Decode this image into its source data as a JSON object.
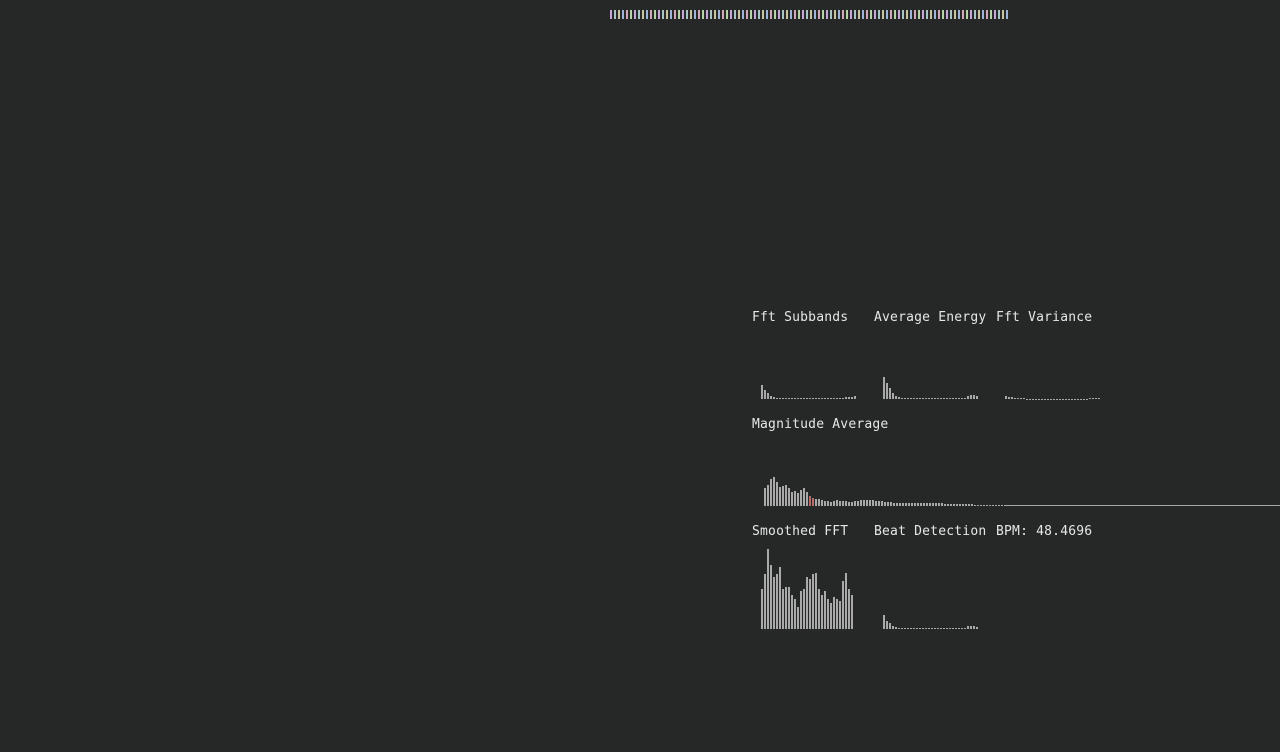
{
  "labels": {
    "fft_subbands": "Fft Subbands",
    "average_energy": "Average Energy",
    "fft_variance": "Fft Variance",
    "magnitude_average": "Magnitude Average",
    "smoothed_fft": "Smoothed FFT",
    "beat_detection": "Beat Detection",
    "bpm": "BPM: 48.4696"
  },
  "colors": {
    "background": "#262828",
    "bar": "#a9a9a9",
    "highlight": "#b86b6b",
    "text": "#e6e6e6"
  },
  "chart_data": [
    {
      "type": "bar",
      "name": "color-strip",
      "values_count": 100,
      "palette": [
        "#c7a6d6",
        "#a6c7c1",
        "#c9c49b",
        "#9fb6d8",
        "#d6a7b8",
        "#b7d3a6"
      ]
    },
    {
      "type": "bar",
      "name": "fft-subbands",
      "values": [
        14,
        9,
        6,
        3,
        2,
        1,
        1,
        1,
        1,
        1,
        1,
        1,
        1,
        1,
        1,
        1,
        1,
        1,
        1,
        1,
        1,
        1,
        1,
        1,
        1,
        1,
        1,
        1,
        2,
        2,
        2,
        3
      ]
    },
    {
      "type": "bar",
      "name": "average-energy",
      "values": [
        22,
        16,
        11,
        6,
        3,
        2,
        1,
        1,
        1,
        1,
        1,
        1,
        1,
        1,
        1,
        1,
        1,
        1,
        1,
        1,
        1,
        1,
        1,
        1,
        1,
        1,
        1,
        1,
        3,
        4,
        4,
        3
      ]
    },
    {
      "type": "bar",
      "name": "fft-variance",
      "values": [
        3,
        2,
        2,
        1,
        1,
        1,
        1,
        0,
        0,
        0,
        0,
        0,
        0,
        0,
        0,
        0,
        0,
        0,
        0,
        0,
        0,
        0,
        0,
        0,
        0,
        0,
        0,
        0,
        1,
        1,
        1,
        1
      ]
    },
    {
      "type": "bar",
      "name": "magnitude-average",
      "values": [
        18,
        21,
        27,
        29,
        24,
        19,
        20,
        21,
        18,
        14,
        15,
        13,
        16,
        18,
        14,
        10,
        8,
        7,
        7,
        6,
        5,
        5,
        4,
        5,
        6,
        5,
        5,
        5,
        4,
        4,
        5,
        5,
        6,
        6,
        6,
        6,
        6,
        5,
        5,
        5,
        4,
        4,
        4,
        3,
        3,
        3,
        3,
        3,
        3,
        3,
        3,
        3,
        3,
        3,
        3,
        3,
        3,
        3,
        3,
        3,
        2,
        2,
        2,
        2,
        2,
        2,
        2,
        2,
        2,
        2,
        1,
        1,
        1,
        1,
        1,
        1,
        1,
        1,
        1,
        1
      ],
      "highlight_indices": [
        15,
        16
      ]
    },
    {
      "type": "bar",
      "name": "smoothed-fft",
      "values": [
        40,
        55,
        80,
        64,
        52,
        55,
        62,
        40,
        42,
        42,
        34,
        30,
        22,
        38,
        40,
        52,
        50,
        55,
        56,
        40,
        34,
        38,
        30,
        26,
        32,
        30,
        28,
        48,
        56,
        40,
        34
      ],
      "ylim": [
        0,
        80
      ]
    },
    {
      "type": "bar",
      "name": "beat-detection",
      "values": [
        14,
        8,
        6,
        3,
        2,
        1,
        1,
        1,
        1,
        1,
        1,
        1,
        1,
        1,
        1,
        1,
        1,
        1,
        1,
        1,
        1,
        1,
        1,
        1,
        1,
        1,
        1,
        1,
        3,
        3,
        3,
        2
      ]
    }
  ]
}
